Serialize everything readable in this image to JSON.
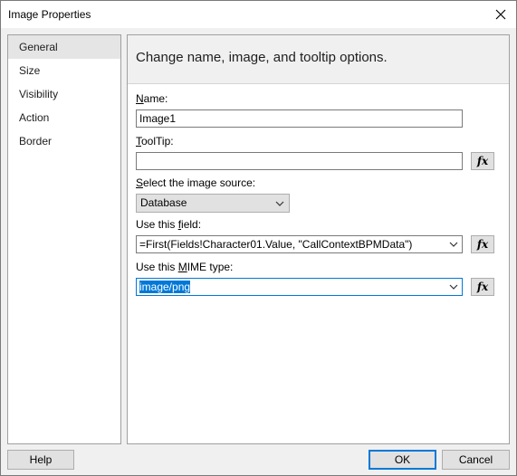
{
  "window": {
    "title": "Image Properties"
  },
  "nav": {
    "items": [
      {
        "label": "General",
        "selected": true
      },
      {
        "label": "Size"
      },
      {
        "label": "Visibility"
      },
      {
        "label": "Action"
      },
      {
        "label": "Border"
      }
    ]
  },
  "panel": {
    "heading": "Change name, image, and tooltip options.",
    "name": {
      "label_accel": "N",
      "label_rest": "ame:",
      "value": "Image1"
    },
    "tooltip": {
      "label_accel": "T",
      "label_rest": "oolTip:",
      "value": ""
    },
    "source": {
      "label_accel": "S",
      "label_rest": "elect the image source:",
      "value": "Database"
    },
    "field": {
      "label_pre": "Use this ",
      "label_accel": "f",
      "label_rest": "ield:",
      "value": "=First(Fields!Character01.Value, \"CallContextBPMData\")"
    },
    "mime": {
      "label_pre": "Use this ",
      "label_accel": "M",
      "label_rest": "IME type:",
      "value": "image/png"
    },
    "fx_label": "fx"
  },
  "buttons": {
    "help": "Help",
    "ok": "OK",
    "cancel": "Cancel"
  }
}
